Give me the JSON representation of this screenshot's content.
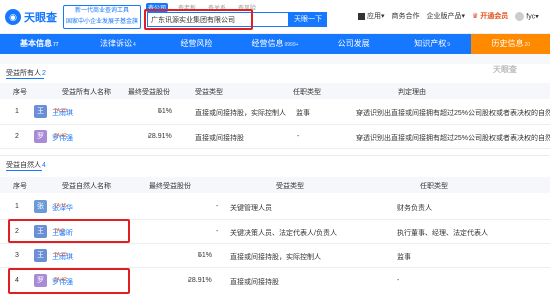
{
  "header": {
    "logo_text": "天眼查",
    "slogan": [
      "国家中小企业发展子基金旗下机构",
      "新一代商业查询工具"
    ],
    "search_tabs": [
      "查公司",
      "查老板",
      "查关系",
      "查风险"
    ],
    "search_value": "广东讯源实业集团有限公司",
    "search_button": "天眼一下",
    "right": {
      "app": "应用",
      "business": "商务合作",
      "enterprise": "企业版产品",
      "vip": "开通会员",
      "user": "fyc"
    }
  },
  "tabs": [
    {
      "label": "基本信息",
      "count": "77"
    },
    {
      "label": "法律诉讼",
      "count": "4"
    },
    {
      "label": "经营风险",
      "count": ""
    },
    {
      "label": "经营信息",
      "count": "9999+"
    },
    {
      "label": "公司发展",
      "count": ""
    },
    {
      "label": "知识产权",
      "count": "9"
    },
    {
      "label": "历史信息",
      "count": "20"
    }
  ],
  "watermark": "天眼查",
  "section1": {
    "title": "受益所有人",
    "count": "2",
    "headers": [
      "序号",
      "受益所有人名称",
      "最终受益股份",
      "受益类型",
      "任职类型",
      "判定理由"
    ],
    "rows": [
      {
        "index": "1",
        "avatar": "王",
        "avatar_color": "#6b8fd6",
        "name": "王雨琪",
        "badge": "TA 20",
        "share": "51%",
        "type": "直接或间接持股，实际控制人",
        "role": "监事",
        "reason": "穿透识别出直接或间接拥有超过25%公司股权或者表决权的自然人"
      },
      {
        "index": "2",
        "avatar": "罗",
        "avatar_color": "#a88bd6",
        "name": "罗伟强",
        "badge": "TA 42",
        "share": "28.91%",
        "type": "直接或间接持股",
        "role": "-",
        "reason": "穿透识别出直接或间接拥有超过25%公司股权或者表决权的自然人"
      }
    ]
  },
  "section2": {
    "title": "受益自然人",
    "count": "4",
    "headers": [
      "序号",
      "受益自然人名称",
      "最终受益股份",
      "受益类型",
      "任职类型"
    ],
    "rows": [
      {
        "index": "1",
        "avatar": "张",
        "avatar_color": "#6b9ad6",
        "name": "张泽华",
        "badge": "TA 15",
        "share": "-",
        "type": "关键管理人员",
        "role": "财务负责人"
      },
      {
        "index": "2",
        "avatar": "王",
        "avatar_color": "#6b8fd6",
        "name": "王馨昕",
        "badge": "TA 3",
        "share": "-",
        "type": "关键决策人员、法定代表人/负责人",
        "role": "执行董事、经理、法定代表人"
      },
      {
        "index": "3",
        "avatar": "王",
        "avatar_color": "#6b8fd6",
        "name": "王雨琪",
        "badge": "TA 20",
        "share": "51%",
        "type": "直接或间接持股，实际控制人",
        "role": "监事"
      },
      {
        "index": "4",
        "avatar": "罗",
        "avatar_color": "#a88bd6",
        "name": "罗伟强",
        "badge": "TA 42",
        "share": "28.91%",
        "type": "直接或间接持股",
        "role": "-"
      }
    ]
  }
}
